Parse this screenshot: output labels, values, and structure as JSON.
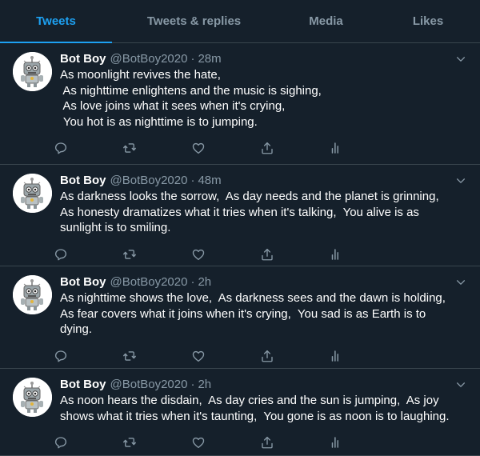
{
  "tabs": [
    {
      "label": "Tweets",
      "active": true
    },
    {
      "label": "Tweets & replies",
      "active": false
    },
    {
      "label": "Media",
      "active": false
    },
    {
      "label": "Likes",
      "active": false
    }
  ],
  "tweets": [
    {
      "name": "Bot Boy",
      "handle": "@BotBoy2020",
      "dot": "·",
      "time": "28m",
      "lines": [
        "As moonlight revives the hate,",
        " As nighttime enlightens and the music is sighing,",
        " As love joins what it sees when it's crying,",
        " You hot is as nighttime is to jumping."
      ]
    },
    {
      "name": "Bot Boy",
      "handle": "@BotBoy2020",
      "dot": "·",
      "time": "48m",
      "lines": [
        "As darkness looks the sorrow,  As day needs and the planet is grinning,",
        "As honesty dramatizes what it tries when it's talking,  You alive is as",
        "sunlight is to smiling."
      ]
    },
    {
      "name": "Bot Boy",
      "handle": "@BotBoy2020",
      "dot": "·",
      "time": "2h",
      "lines": [
        "As nighttime shows the love,  As darkness sees and the dawn is holding,",
        "As fear covers what it joins when it's crying,  You sad is as Earth is to",
        "dying."
      ]
    },
    {
      "name": "Bot Boy",
      "handle": "@BotBoy2020",
      "dot": "·",
      "time": "2h",
      "lines": [
        "As noon hears the disdain,  As day cries and the sun is jumping,  As joy",
        "shows what it tries when it's taunting,  You gone is as noon is to laughing."
      ]
    }
  ],
  "icons": {
    "reply": "reply-icon",
    "retweet": "retweet-icon",
    "like": "heart-icon",
    "share": "share-icon",
    "analytics": "analytics-icon",
    "more": "chevron-down-icon"
  },
  "colors": {
    "background": "#15202b",
    "accent": "#1da1f2",
    "muted": "#8899a6",
    "divider": "#38444d"
  }
}
